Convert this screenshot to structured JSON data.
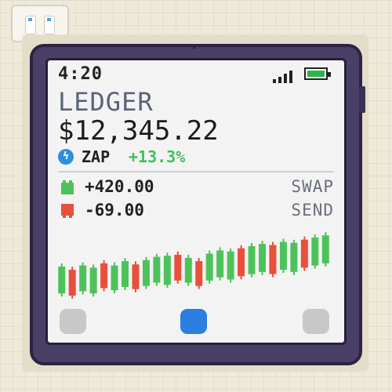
{
  "status": {
    "time": "4:20"
  },
  "wallet": {
    "title": "LEDGER",
    "balance": "$12,345.22",
    "token": {
      "name": "ZAP",
      "change": "+13.3%",
      "icon": "zap-token-icon"
    }
  },
  "transactions": [
    {
      "amount": "+420.00",
      "action": "SWAP",
      "status_color": "#4ec25a"
    },
    {
      "amount": "-69.00",
      "action": "SEND",
      "status_color": "#e8503c"
    }
  ],
  "colors": {
    "up": "#4ec25a",
    "down": "#e8503c",
    "accent": "#2b7fe0",
    "device": "#4a3f66",
    "screen": "#f3f3f3"
  },
  "nav": [
    {
      "icon": "nav-left-button",
      "active": false
    },
    {
      "icon": "nav-home-button",
      "active": true
    },
    {
      "icon": "nav-right-button",
      "active": false
    }
  ],
  "chart_data": {
    "type": "bar",
    "series": [
      {
        "values": [
          {
            "low": 40,
            "high": 65,
            "dir": "up"
          },
          {
            "low": 38,
            "high": 62,
            "dir": "down"
          },
          {
            "low": 42,
            "high": 66,
            "dir": "up"
          },
          {
            "low": 40,
            "high": 64,
            "dir": "up"
          },
          {
            "low": 45,
            "high": 68,
            "dir": "down"
          },
          {
            "low": 43,
            "high": 66,
            "dir": "up"
          },
          {
            "low": 46,
            "high": 70,
            "dir": "up"
          },
          {
            "low": 44,
            "high": 67,
            "dir": "down"
          },
          {
            "low": 47,
            "high": 71,
            "dir": "up"
          },
          {
            "low": 50,
            "high": 74,
            "dir": "up"
          },
          {
            "low": 48,
            "high": 75,
            "dir": "up"
          },
          {
            "low": 52,
            "high": 76,
            "dir": "down"
          },
          {
            "low": 50,
            "high": 73,
            "dir": "up"
          },
          {
            "low": 47,
            "high": 70,
            "dir": "down"
          },
          {
            "low": 52,
            "high": 77,
            "dir": "up"
          },
          {
            "low": 55,
            "high": 80,
            "dir": "up"
          },
          {
            "low": 53,
            "high": 79,
            "dir": "up"
          },
          {
            "low": 56,
            "high": 82,
            "dir": "down"
          },
          {
            "low": 58,
            "high": 84,
            "dir": "up"
          },
          {
            "low": 60,
            "high": 86,
            "dir": "up"
          },
          {
            "low": 58,
            "high": 85,
            "dir": "down"
          },
          {
            "low": 62,
            "high": 88,
            "dir": "up"
          },
          {
            "low": 60,
            "high": 87,
            "dir": "up"
          },
          {
            "low": 64,
            "high": 90,
            "dir": "down"
          },
          {
            "low": 66,
            "high": 92,
            "dir": "up"
          },
          {
            "low": 68,
            "high": 94,
            "dir": "up"
          }
        ]
      }
    ]
  }
}
